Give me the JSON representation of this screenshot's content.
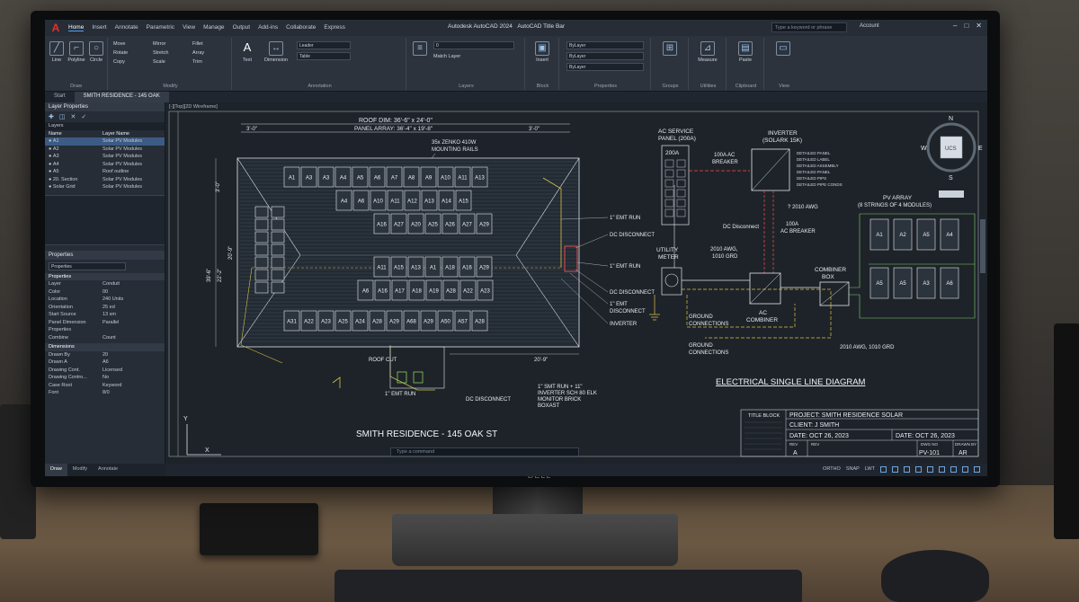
{
  "window": {
    "title": "Autodesk AutoCAD 2024",
    "subtitle": "AutoCAD Title Bar",
    "search_placeholder": "Type a keyword or phrase",
    "user": "Account"
  },
  "menu_tabs": [
    "Home",
    "Insert",
    "Annotate",
    "Parametric",
    "View",
    "Manage",
    "Output",
    "Add-ins",
    "Collaborate",
    "Express"
  ],
  "ribbon": {
    "draw": {
      "label": "Draw",
      "line": "Line",
      "polyline": "Polyline",
      "circle": "Circle",
      "arc": "Arc"
    },
    "modify": {
      "label": "Modify",
      "items": [
        "Move",
        "Rotate",
        "Copy",
        "Mirror",
        "Stretch",
        "Scale",
        "Fillet",
        "Array",
        "Trim"
      ]
    },
    "annotation": {
      "label": "Annotation",
      "text": "Text",
      "dimension": "Dimension",
      "leader": "Leader",
      "table": "Table"
    },
    "layers": {
      "label": "Layers",
      "combo": "0",
      "match": "Match Layer"
    },
    "block": {
      "label": "Block",
      "insert": "Insert"
    },
    "properties": {
      "label": "Properties",
      "bylayer1": "ByLayer",
      "bylayer2": "ByLayer",
      "bylayer3": "ByLayer"
    },
    "groups": {
      "label": "Groups"
    },
    "utilities": {
      "label": "Utilities",
      "measure": "Measure"
    },
    "clipboard": {
      "label": "Clipboard",
      "paste": "Paste"
    },
    "view": {
      "label": "View"
    }
  },
  "doc_tabs": [
    "Start",
    "SMITH RESIDENCE - 145 OAK"
  ],
  "viewport_label": "[-][Top][2D Wireframe]",
  "layer_panel": {
    "title": "Layer Properties",
    "filter": "Layers",
    "columns": [
      "Name",
      "Layer Name"
    ],
    "rows": [
      {
        "name": "A1",
        "desc": "Solar PV Modules"
      },
      {
        "name": "A2",
        "desc": "Solar PV Modules"
      },
      {
        "name": "A3",
        "desc": "Solar PV Modules"
      },
      {
        "name": "A4",
        "desc": "Solar PV Modules"
      },
      {
        "name": "A5",
        "desc": "Roof outline"
      },
      {
        "name": "20. Section",
        "desc": "Solar PV Modules"
      },
      {
        "name": "Solar Grid",
        "desc": "Solar PV Modules"
      }
    ]
  },
  "properties_panel": {
    "title": "Properties",
    "selector": "Properties",
    "section1": "Properties",
    "rows1": [
      {
        "k": "Layer",
        "v": "Conduit"
      },
      {
        "k": "Color",
        "v": "00"
      },
      {
        "k": "Location",
        "v": "240 Units"
      },
      {
        "k": "Orientation",
        "v": "25 ed"
      },
      {
        "k": "Start Source",
        "v": "13 sm"
      },
      {
        "k": "Panel Dimension",
        "v": "Parallel"
      },
      {
        "k": "Properties",
        "v": ""
      },
      {
        "k": "Combine",
        "v": "Count"
      }
    ],
    "section2": "Dimensions",
    "rows2": [
      {
        "k": "Drawn By",
        "v": "20"
      },
      {
        "k": "Drawn A",
        "v": "A6"
      },
      {
        "k": "Drawing Cont.",
        "v": "Licensed"
      },
      {
        "k": "Drawing Contro...",
        "v": "No"
      },
      {
        "k": "Case Root",
        "v": "Keyword"
      },
      {
        "k": "Font",
        "v": "8/0"
      }
    ]
  },
  "bottom_tabs": [
    "Draw",
    "Modify",
    "Annotate"
  ],
  "plan": {
    "roof_dim": "ROOF DIM: 36'-6\" x 24'-0\"",
    "panel_array": "PANEL ARRAY: 36'-4\" x 19'-8\"",
    "dim_3ft": "3'-0\"",
    "dim_3ft_right": "3'-0\"",
    "rails_note_1": "35x ZENKO 410W",
    "rails_note_2": "MOUNTING RAILS",
    "left_dim_1": "3'-0\"",
    "left_dim_2": "39'-6\"",
    "left_dim_3": "22'-2\"",
    "left_dim_4": "20'-9\"",
    "bottom_dim": "20'-9\"",
    "row1": [
      "A1",
      "A3",
      "A3",
      "A4",
      "A5",
      "A6",
      "A7",
      "A8",
      "A9",
      "A10",
      "A11",
      "A13"
    ],
    "row2": [
      "A4",
      "A6",
      "A10",
      "A11",
      "A12",
      "A13",
      "A14",
      "A15"
    ],
    "row3": [
      "A16",
      "A27",
      "A20",
      "A25",
      "A26",
      "A27",
      "A29"
    ],
    "row4": [
      "A11",
      "A15",
      "A13",
      "A1",
      "A18",
      "A16",
      "A29"
    ],
    "row5": [
      "A6",
      "A16",
      "A17",
      "A18",
      "A19",
      "A28",
      "A22",
      "A23"
    ],
    "row6": [
      "A31",
      "A22",
      "A23",
      "A25",
      "A24",
      "A28",
      "A29",
      "A68",
      "A29",
      "A50",
      "A57",
      "A28"
    ],
    "labels": {
      "emt1": "1\" EMT RUN",
      "dc1": "DC DISCONNECT",
      "emt2": "1\" EMT RUN",
      "dc2": "DC DISCONNECT",
      "emt3": "1\" EMT",
      "emt3b": "DISCONNECT",
      "inverter": "INVERTER",
      "roof_cut": "ROOF CUT",
      "emt_run_b": "1\" EMT RUN",
      "dc_b": "DC DISCONNECT",
      "smt_note_1": "1\" SMT RUN + 11\"",
      "smt_note_2": "INVERTER SCH 80 ELK",
      "smt_note_3": "MONITOR BRICK",
      "smt_note_4": "BOXAST"
    },
    "title": "SMITH RESIDENCE - 145 OAK ST"
  },
  "sld": {
    "ac_service_1": "AC SERVICE",
    "ac_service_2": "PANEL (200A)",
    "ac_200": "200A",
    "breaker_1": "100A AC",
    "breaker_2": "BREAKER",
    "inverter_1": "INVERTER",
    "inverter_2": "(SOLARK 15K)",
    "inv_notes": [
      "DETAILED PANEL",
      "DETAILED LABEL",
      "DETAILED ASSEMBLY",
      "DETAILED PANEL",
      "DETAILED PIPS",
      "DETAILED PIPE CONDS"
    ],
    "awg_note": "? 2010 AWG",
    "pv_array_1": "PV ARRAY",
    "pv_array_2": "(8 STRINGS OF 4 MODULES)",
    "pv_top": [
      "A1",
      "A2",
      "A5",
      "A4"
    ],
    "pv_bot": [
      "A5",
      "A5",
      "A3",
      "A6"
    ],
    "dc_disc": "DC Disconnect",
    "ac_breaker_1": "100A",
    "ac_breaker_2": "AC BREAKER",
    "utility_1": "UTILITY",
    "utility_2": "METER",
    "awg_1": "2010 AWG,",
    "awg_2": "1010 GRD",
    "combiner_1": "COMBINER",
    "combiner_2": "BOX",
    "ac_comb_1": "AC",
    "ac_comb_2": "COMBINER",
    "ground_1": "GROUND",
    "ground_2": "CONNECTIONS",
    "ground_3": "GROUND",
    "ground_4": "CONNECTIONS",
    "awg_grd": "2010 AWG, 1010 GRD",
    "title": "ELECTRICAL SINGLE LINE DIAGRAM"
  },
  "title_block": {
    "label": "TITLE BLOCK",
    "project": "PROJECT: SMITH RESIDENCE SOLAR",
    "client": "CLIENT: J SMITH",
    "date1": "DATE: OCT 26, 2023",
    "date2": "DATE: OCT 26, 2023",
    "rev_label": "REV",
    "rev": "A",
    "rev2_label": "REV",
    "dwg_label": "DWG NO",
    "dwg": "PV-101",
    "drawn_label": "DRAWN BY",
    "drawn": "AR"
  },
  "compass": {
    "n": "N",
    "s": "S",
    "e": "E",
    "w": "W",
    "center": "UCS"
  },
  "axis": {
    "x": "X",
    "y": "Y"
  },
  "command_line": "Type a command",
  "status": [
    "ORTHO",
    "SNAP",
    "LWT"
  ],
  "monitor_brand": "DELL"
}
